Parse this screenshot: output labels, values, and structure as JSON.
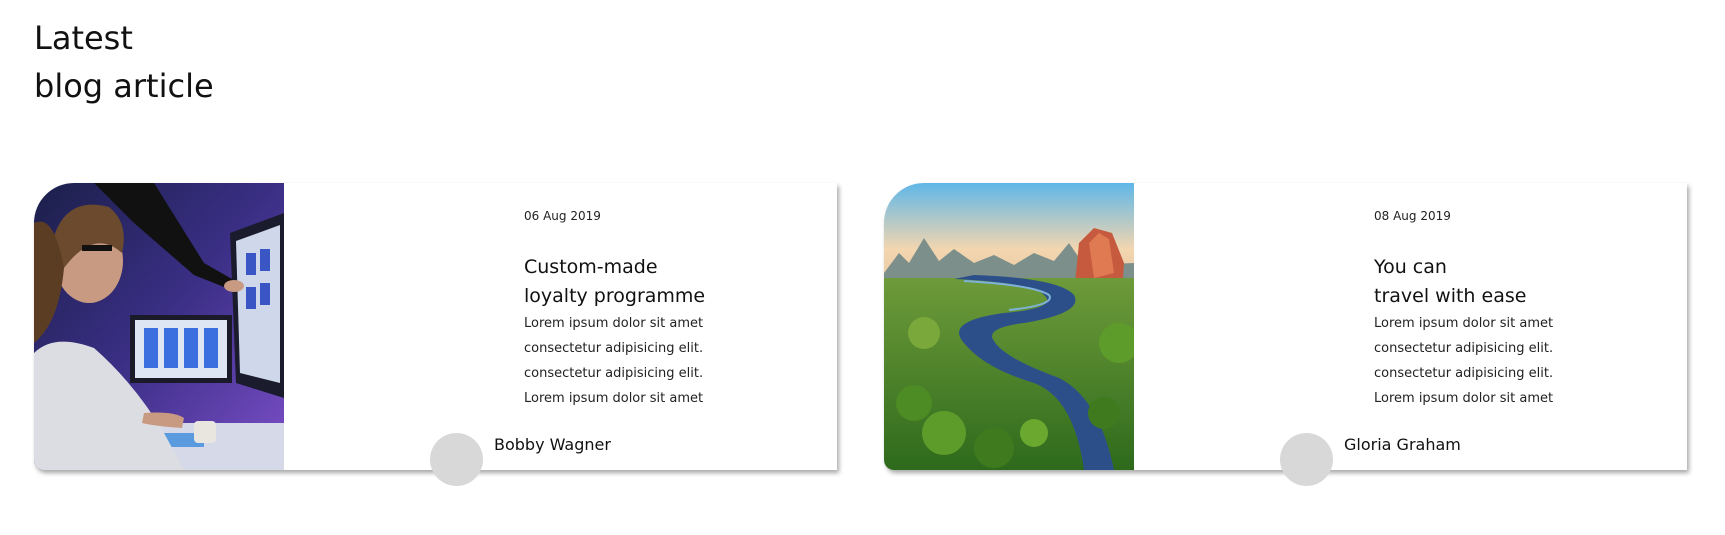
{
  "section": {
    "title_line1": "Latest",
    "title_line2": "blog article"
  },
  "posts": [
    {
      "date": "06 Aug 2019",
      "title_line1": "Custom-made",
      "title_line2": "loyalty programme",
      "excerpt_lines": [
        "Lorem ipsum dolor sit amet",
        "consectetur adipisicing elit.",
        "consectetur adipisicing elit.",
        "Lorem ipsum dolor sit amet"
      ],
      "author": "Bobby Wagner",
      "image": "designer-at-computer-photo"
    },
    {
      "date": "08 Aug 2019",
      "title_line1": "You can",
      "title_line2": "travel with ease",
      "excerpt_lines": [
        "Lorem ipsum dolor sit amet",
        "consectetur adipisicing elit.",
        "consectetur adipisicing elit.",
        "Lorem ipsum dolor sit amet"
      ],
      "author": "Gloria Graham",
      "image": "river-landscape-photo"
    }
  ],
  "colors": {
    "text": "#111111",
    "avatar_placeholder": "#d8d8d8",
    "card_background": "#ffffff"
  }
}
